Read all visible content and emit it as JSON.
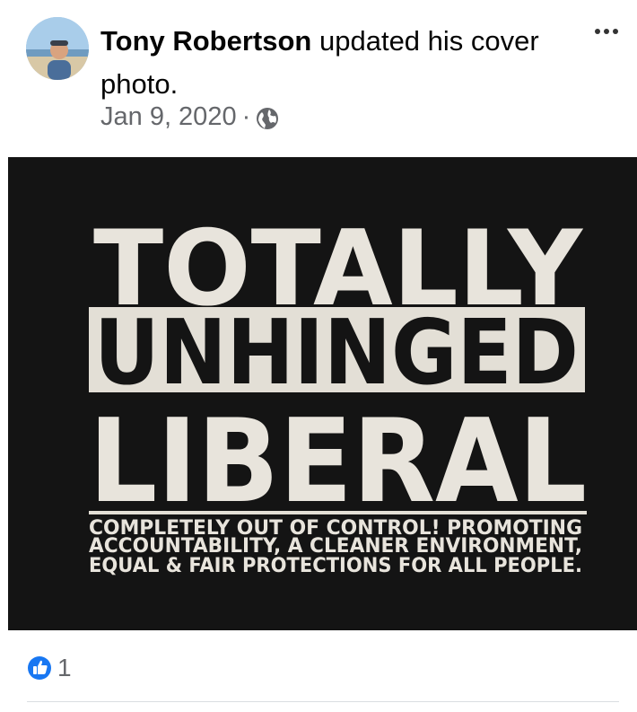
{
  "post": {
    "author": "Tony Robertson",
    "action": " updated his cover photo.",
    "date": "Jan 9, 2020",
    "separator": "·",
    "privacy_icon": "globe-icon",
    "more_icon": "more-options-icon"
  },
  "photo": {
    "line1": "TOTALLY",
    "line2": "UNHINGED",
    "line3": "LIBERAL",
    "caption1": "COMPLETELY OUT OF CONTROL! PROMOTING",
    "caption2": "ACCOUNTABILITY, A CLEANER ENVIRONMENT,",
    "caption3": "EQUAL & FAIR PROTECTIONS FOR ALL PEOPLE."
  },
  "reactions": {
    "icon": "like-icon",
    "count": "1",
    "color": "#1877f2"
  }
}
